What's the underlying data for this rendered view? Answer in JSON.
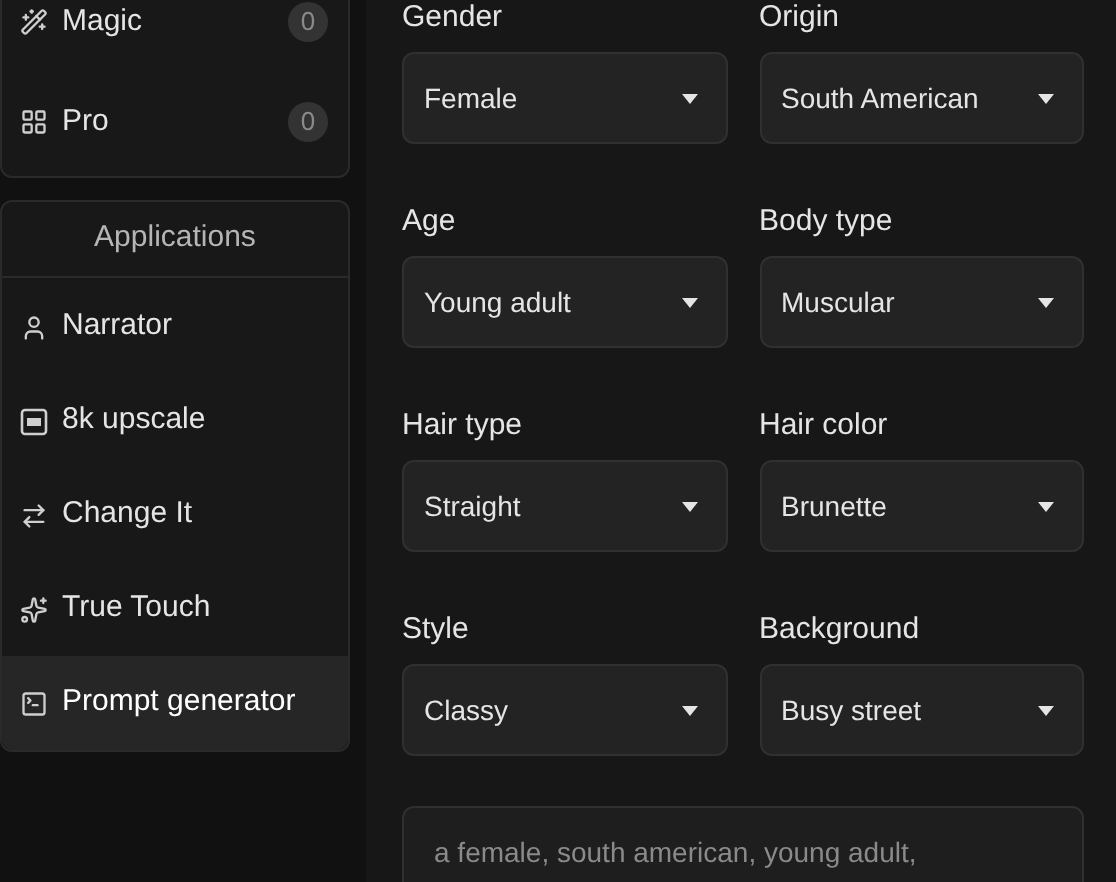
{
  "sidebar": {
    "top_items": [
      {
        "label": "Magic",
        "count": "0"
      },
      {
        "label": "Pro",
        "count": "0"
      }
    ],
    "section_title": "Applications",
    "items": [
      {
        "label": "Narrator",
        "selected": false
      },
      {
        "label": "8k upscale",
        "selected": false
      },
      {
        "label": "Change It",
        "selected": false
      },
      {
        "label": "True Touch",
        "selected": false
      },
      {
        "label": "Prompt generator",
        "selected": true
      }
    ]
  },
  "form": {
    "fields": [
      {
        "label": "Gender",
        "value": "Female"
      },
      {
        "label": "Origin",
        "value": "South American"
      },
      {
        "label": "Age",
        "value": "Young adult"
      },
      {
        "label": "Body type",
        "value": "Muscular"
      },
      {
        "label": "Hair type",
        "value": "Straight"
      },
      {
        "label": "Hair color",
        "value": "Brunette"
      },
      {
        "label": "Style",
        "value": "Classy"
      },
      {
        "label": "Background",
        "value": "Busy street"
      }
    ],
    "prompt": {
      "placeholder": "a female, south american, young adult,"
    }
  }
}
